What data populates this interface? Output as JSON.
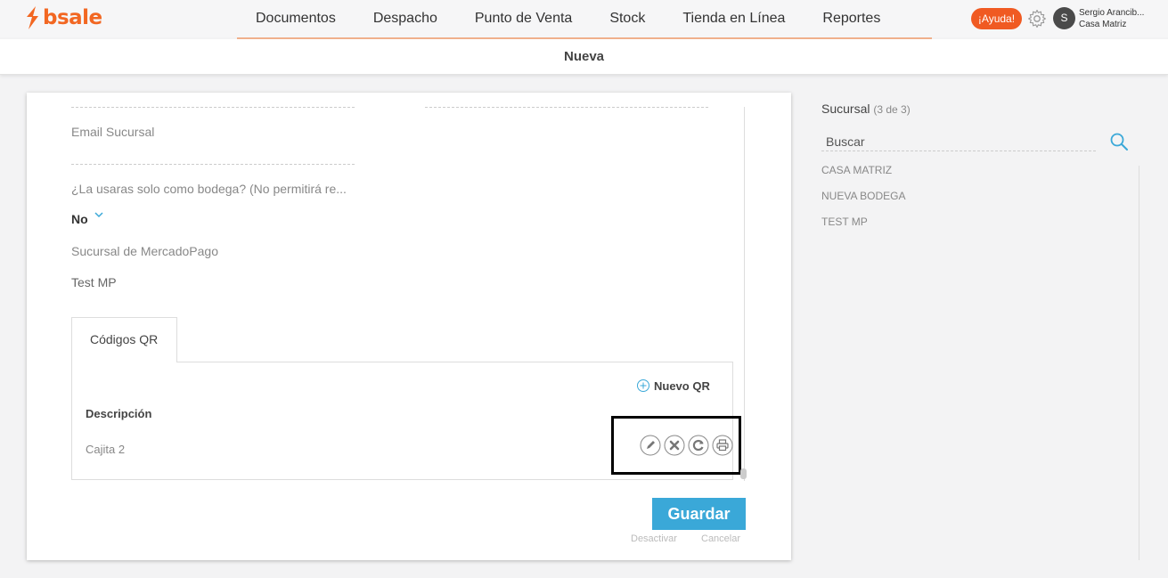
{
  "brand": {
    "name": "bsale",
    "color": "#f26722"
  },
  "nav": {
    "items": [
      "Documentos",
      "Despacho",
      "Punto de Venta",
      "Stock",
      "Tienda en Línea",
      "Reportes"
    ]
  },
  "header": {
    "help_label": "¡Ayuda!",
    "avatar_initial": "S",
    "user_name": "Sergio Arancib...",
    "user_branch": "Casa Matriz"
  },
  "subbar": {
    "title": "Nueva"
  },
  "form": {
    "email_label": "Email Sucursal",
    "warehouse_question": "¿La usaras solo como bodega? (No permitirá re...",
    "warehouse_value": "No",
    "mercadopago_label": "Sucursal de MercadoPago",
    "mercadopago_value": "Test MP"
  },
  "qr": {
    "tab_label": "Códigos QR",
    "new_label": "Nuevo QR",
    "column_header": "Descripción",
    "rows": [
      {
        "description": "Cajita 2"
      }
    ],
    "actions": [
      "edit-icon",
      "delete-icon",
      "refresh-icon",
      "print-icon"
    ]
  },
  "buttons": {
    "save": "Guardar",
    "deactivate": "Desactivar",
    "cancel": "Cancelar"
  },
  "sidebar": {
    "title": "Sucursal",
    "count": "(3 de 3)",
    "search_placeholder": "Buscar",
    "branches": [
      "CASA MATRIZ",
      "NUEVA BODEGA",
      "TEST MP"
    ]
  },
  "colors": {
    "accent": "#3aa8d8",
    "help": "#f05a22",
    "nav_underline": "#f0b08c"
  }
}
